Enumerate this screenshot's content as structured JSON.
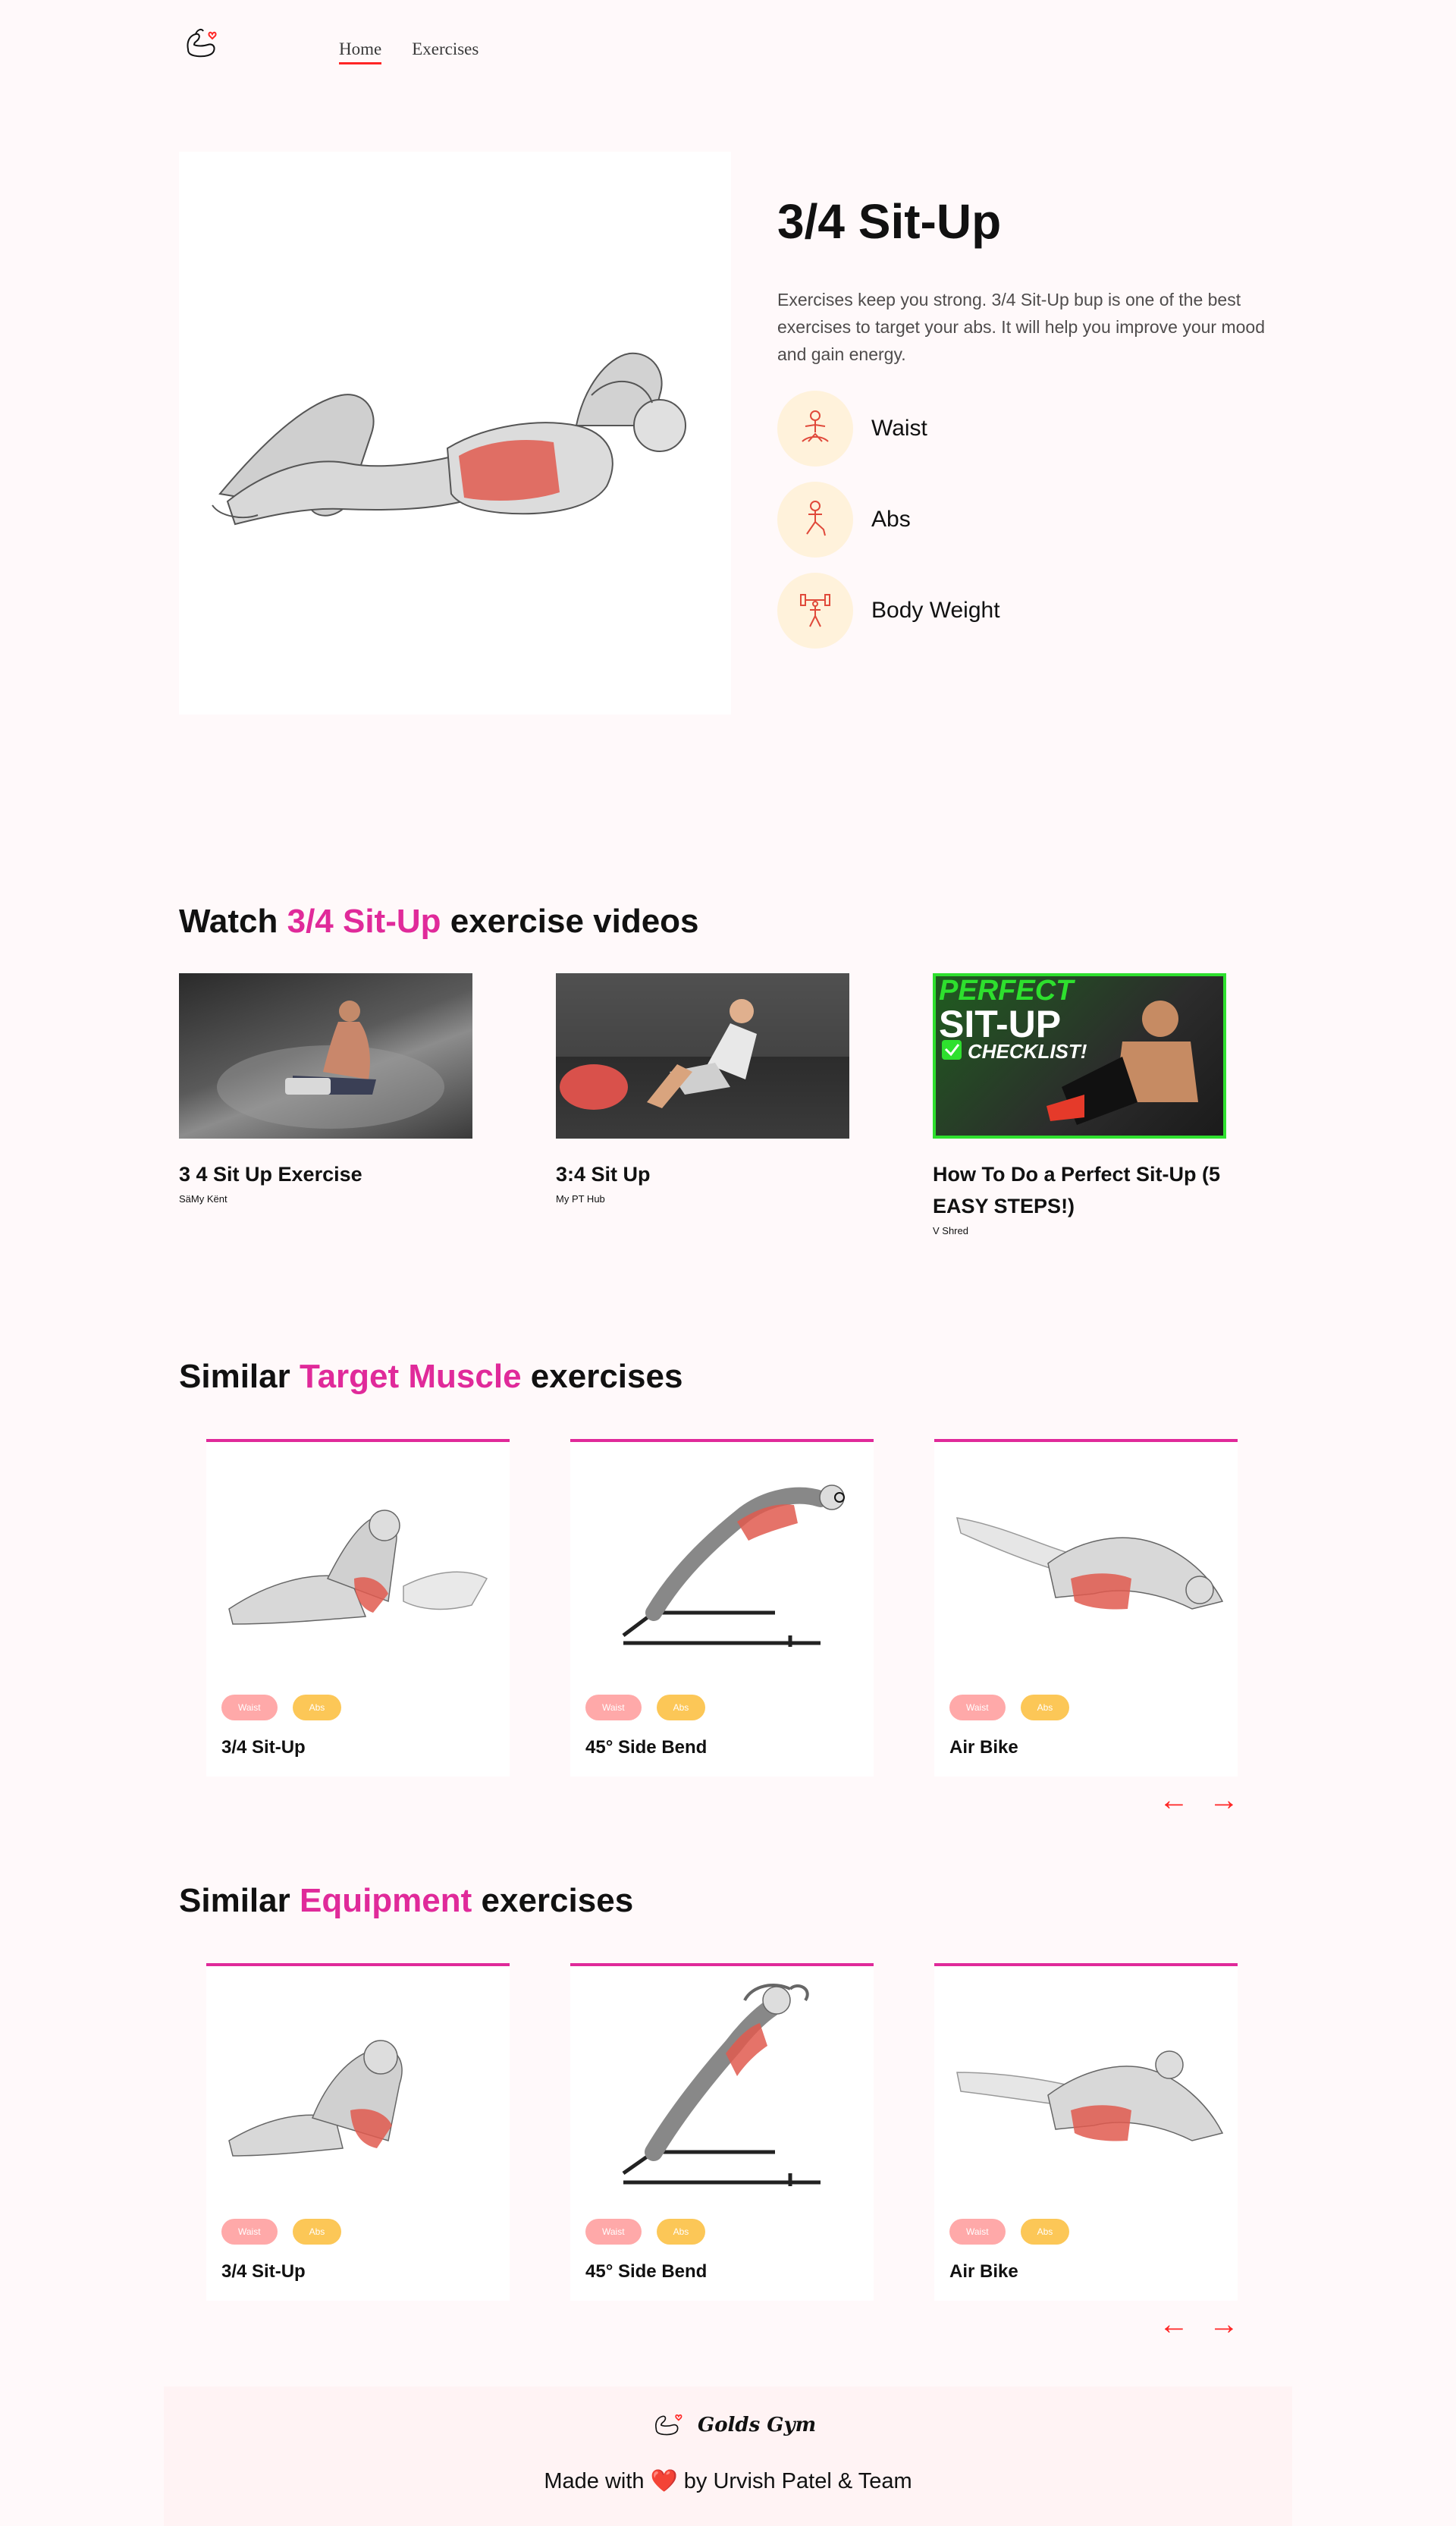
{
  "nav": {
    "links": [
      "Home",
      "Exercises"
    ]
  },
  "exercise": {
    "name": "3/4 Sit-Up",
    "description": "Exercises keep you strong. 3/4 Sit-Up bup is one of the best exercises to target your abs. It will help you improve your mood and gain energy.",
    "details": [
      {
        "icon": "body-part-icon",
        "label": "Waist"
      },
      {
        "icon": "target-icon",
        "label": "Abs"
      },
      {
        "icon": "equipment-icon",
        "label": "Body Weight"
      }
    ]
  },
  "videos_section": {
    "prefix": "Watch ",
    "highlight": "3/4 Sit-Up",
    "suffix": " exercise videos",
    "videos": [
      {
        "title": "3 4 Sit Up Exercise",
        "channel": "SäMy Kënt"
      },
      {
        "title": "3:4 Sit Up",
        "channel": "My PT Hub"
      },
      {
        "title": "How To Do a Perfect Sit-Up (5 EASY STEPS!)",
        "channel": "V Shred",
        "thumb_text_1": "PERFECT",
        "thumb_text_2": "SIT-UP",
        "thumb_text_3": "CHECKLIST!"
      }
    ]
  },
  "target_section": {
    "prefix": "Similar ",
    "highlight": "Target Muscle",
    "suffix": " exercises",
    "cards": [
      {
        "name": "3/4 Sit-Up",
        "tags": [
          "Waist",
          "Abs"
        ]
      },
      {
        "name": "45° Side Bend",
        "tags": [
          "Waist",
          "Abs"
        ]
      },
      {
        "name": "Air Bike",
        "tags": [
          "Waist",
          "Abs"
        ]
      }
    ]
  },
  "equipment_section": {
    "prefix": "Similar ",
    "highlight": "Equipment",
    "suffix": " exercises",
    "cards": [
      {
        "name": "3/4 Sit-Up",
        "tags": [
          "Waist",
          "Abs"
        ]
      },
      {
        "name": "45° Side Bend",
        "tags": [
          "Waist",
          "Abs"
        ]
      },
      {
        "name": "Air Bike",
        "tags": [
          "Waist",
          "Abs"
        ]
      }
    ]
  },
  "arrows": {
    "left": "←",
    "right": "→"
  },
  "footer": {
    "brand": "Golds Gym",
    "made_with": "Made with",
    "heart": "❤️",
    "by": "by Urvish Patel & Team"
  },
  "colors": {
    "accent": "#e02a9a",
    "arrow": "#ff2625",
    "pill_pink": "#ffa9a9",
    "pill_yellow": "#fcc757",
    "icon_bg": "#fff2db"
  }
}
